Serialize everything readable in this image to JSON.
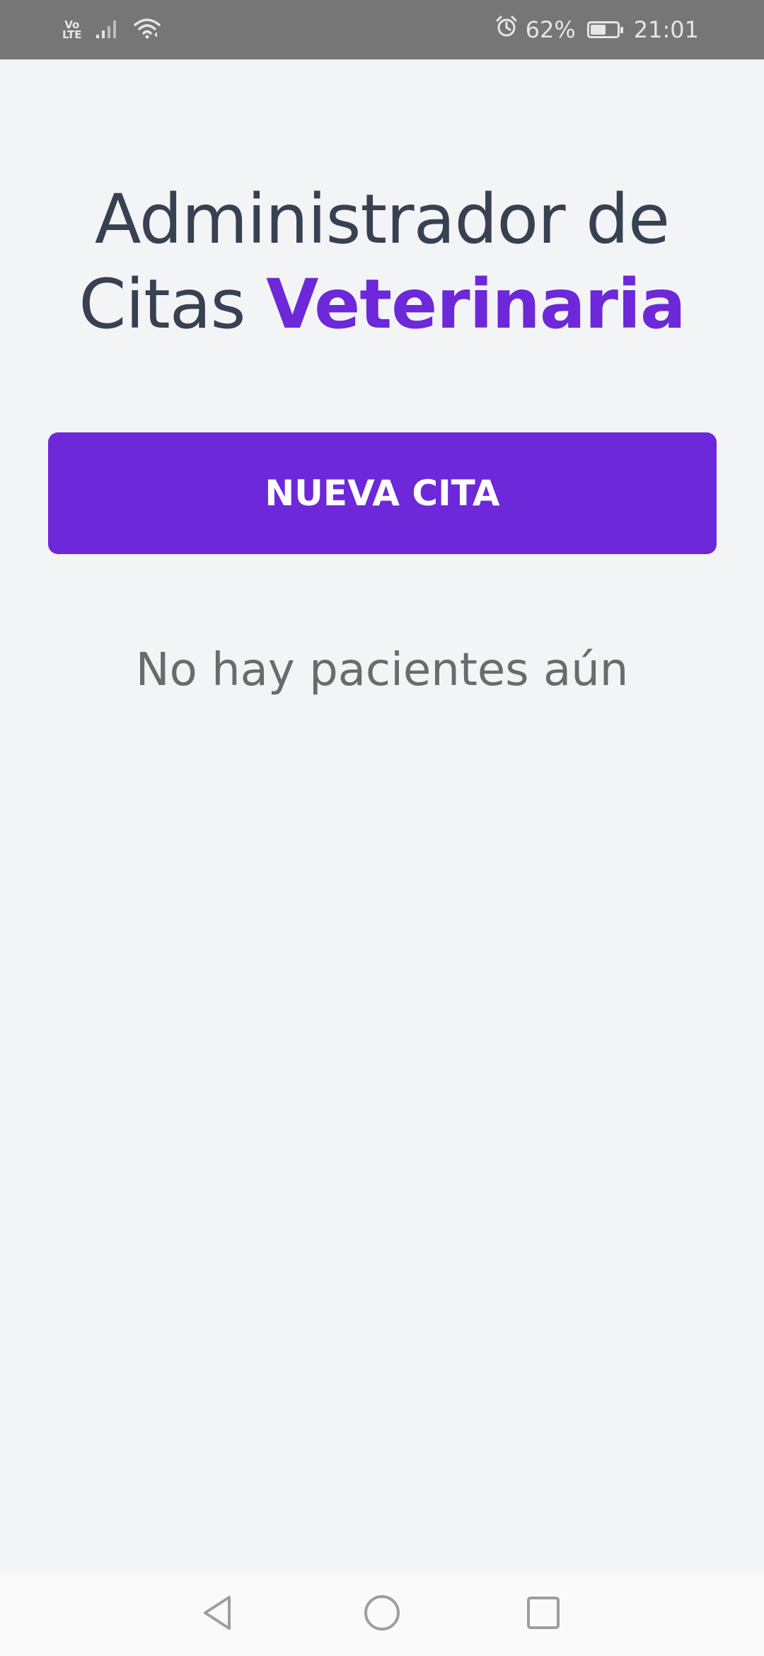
{
  "status_bar": {
    "network_label_top": "Vo",
    "network_label_bottom": "LTE",
    "battery_percent": "62%",
    "battery_level": 0.62,
    "time": "21:01",
    "icons": [
      "signal-icon",
      "wifi-icon",
      "alarm-icon",
      "battery-icon"
    ]
  },
  "header": {
    "title_part1": "Administrador de Citas",
    "title_accent": "Veterinaria"
  },
  "actions": {
    "new_appointment_label": "Nueva Cita"
  },
  "patients": {
    "empty_message": "No hay pacientes aún"
  },
  "colors": {
    "accent": "#6d28d9",
    "title_text": "#374151",
    "background": "#f3f4f6",
    "muted_text": "#6b6b6b"
  },
  "navigation": {
    "icons": [
      "back-icon",
      "home-icon",
      "recents-icon"
    ]
  }
}
